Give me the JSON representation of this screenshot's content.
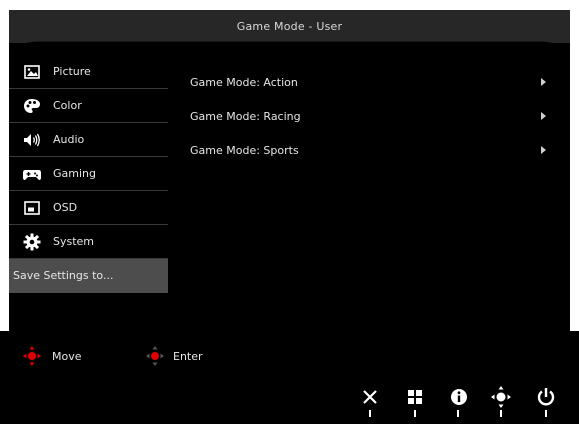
{
  "title": "Game Mode - User",
  "sidebar": {
    "items": [
      {
        "label": "Picture",
        "icon": "picture-icon"
      },
      {
        "label": "Color",
        "icon": "palette-icon"
      },
      {
        "label": "Audio",
        "icon": "speaker-icon"
      },
      {
        "label": "Gaming",
        "icon": "gamepad-icon"
      },
      {
        "label": "OSD",
        "icon": "osd-window-icon"
      },
      {
        "label": "System",
        "icon": "gear-icon"
      },
      {
        "label": "Save Settings to...",
        "selected": true
      }
    ]
  },
  "submenu": {
    "items": [
      {
        "label": "Game Mode: Action"
      },
      {
        "label": "Game Mode: Racing"
      },
      {
        "label": "Game Mode: Sports"
      }
    ]
  },
  "hints": {
    "move_label": "Move",
    "enter_label": "Enter"
  },
  "buttons": [
    "close-icon",
    "menu-grid-icon",
    "info-icon",
    "navigation-icon",
    "power-icon"
  ],
  "colors": {
    "background": "#000000",
    "selected": "#4d4d4d",
    "titlebar": "#272727",
    "joystick_accent": "#e00000"
  }
}
